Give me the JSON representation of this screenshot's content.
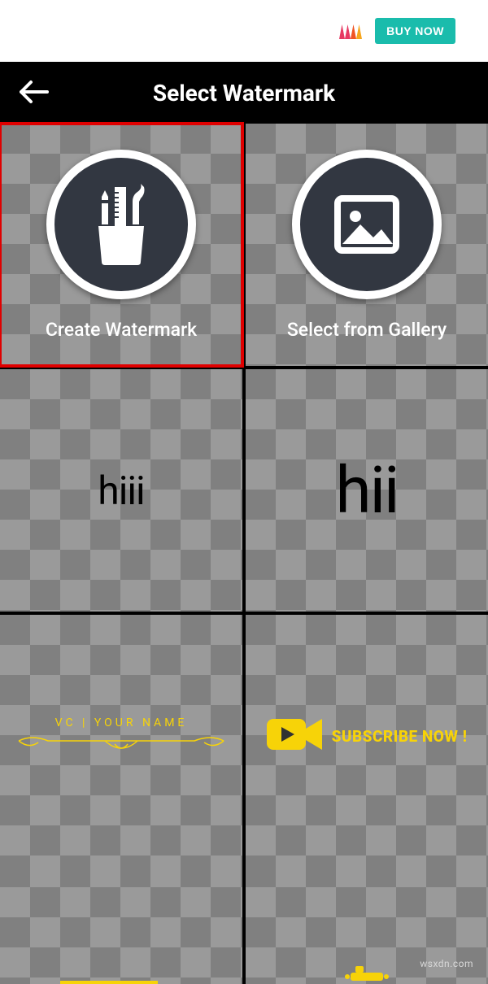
{
  "ad": {
    "cta": "BUY NOW"
  },
  "header": {
    "title": "Select Watermark"
  },
  "tiles": {
    "create": {
      "label": "Create Watermark"
    },
    "gallery": {
      "label": "Select from Gallery"
    },
    "wm1": {
      "text": "hiii"
    },
    "wm2": {
      "text": "hii"
    },
    "wm3": {
      "text": "VC | YOUR NAME"
    },
    "wm4": {
      "text": "SUBSCRIBE NOW !"
    }
  },
  "footer": {
    "credit": "wsxdn.com"
  },
  "colors": {
    "accent_yellow": "#f7d308",
    "circle_bg": "#323741",
    "highlight": "#e00000",
    "cta": "#1abcac"
  }
}
